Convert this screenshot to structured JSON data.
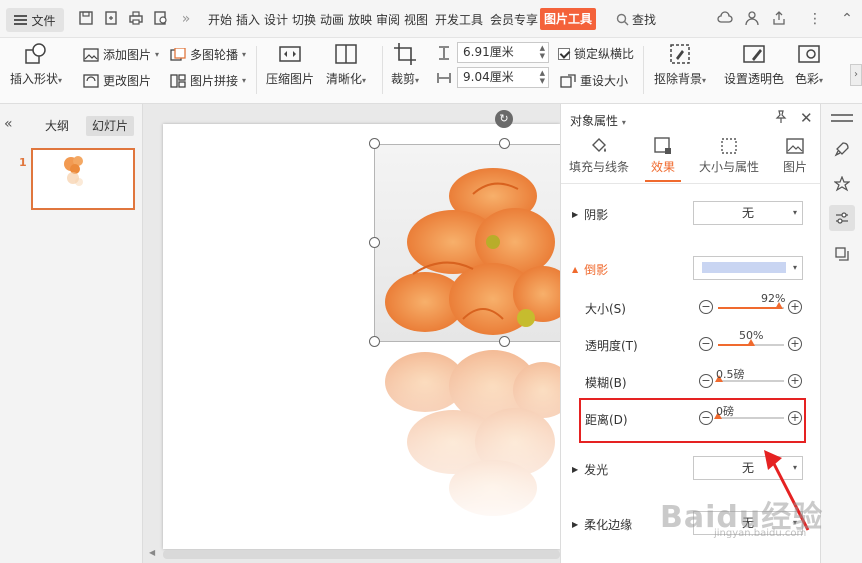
{
  "menubar": {
    "file_label": "文件",
    "tabs": [
      "开始",
      "插入",
      "设计",
      "切换",
      "动画",
      "放映",
      "审阅",
      "视图",
      "开发工具",
      "会员专享",
      "图片工具"
    ],
    "active_tab": "图片工具",
    "search_label": "查找"
  },
  "ribbon": {
    "insert_shape": "插入形状",
    "add_picture": "添加图片",
    "change_picture": "更改图片",
    "multi_carousel": "多图轮播",
    "picture_stitch": "图片拼接",
    "compress_picture": "压缩图片",
    "sharpen": "清晰化",
    "crop": "裁剪",
    "width_value": "6.91厘米",
    "height_value": "9.04厘米",
    "lock_ratio": "锁定纵横比",
    "reset_size": "重设大小",
    "remove_bg": "抠除背景",
    "set_transparent": "设置透明色",
    "color": "色彩"
  },
  "leftpanel": {
    "tab_outline": "大纲",
    "tab_slides": "幻灯片",
    "slide_number": "1"
  },
  "props": {
    "title": "对象属性",
    "tabs": {
      "fill_line": "填充与线条",
      "effects": "效果",
      "size_props": "大小与属性",
      "picture": "图片"
    },
    "shadow": {
      "label": "阴影",
      "value": "无"
    },
    "reflection": {
      "label": "倒影"
    },
    "size": {
      "label": "大小(S)",
      "value_text": "92%",
      "value": 0.92
    },
    "transparency": {
      "label": "透明度(T)",
      "value_text": "50%",
      "value": 0.5
    },
    "blur": {
      "label": "模糊(B)",
      "value_text": "0.5磅",
      "value": 0.02
    },
    "distance": {
      "label": "距离(D)",
      "value_text": "0磅",
      "value": 0.0
    },
    "glow": {
      "label": "发光",
      "value": "无"
    },
    "soft_edges": {
      "label": "柔化边缘",
      "value": "无"
    }
  },
  "watermark": {
    "text": "Baidu经验",
    "sub": "jingyan.baidu.com"
  },
  "colors": {
    "accent": "#f06a2e",
    "active_tab_bg": "#f4623a",
    "highlight": "#e52222"
  }
}
